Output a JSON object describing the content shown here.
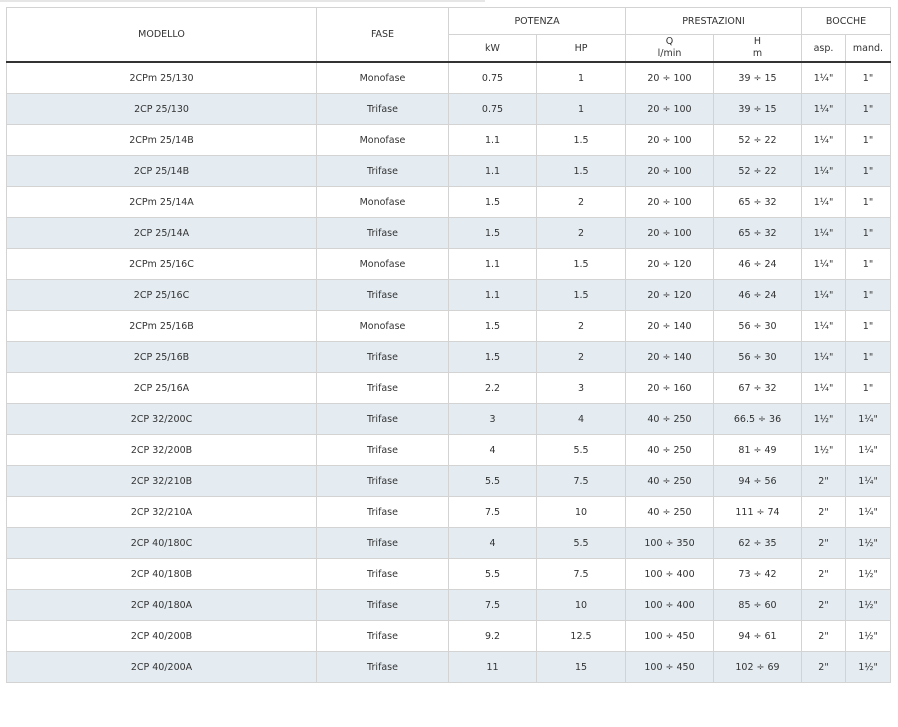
{
  "header": {
    "modello": "MODELLO",
    "fase": "FASE",
    "potenza": "POTENZA",
    "prestazioni": "PRESTAZIONI",
    "bocche": "BOCCHE",
    "kw": "kW",
    "hp": "HP",
    "q": "Q",
    "q_unit": "l/min",
    "h": "H",
    "h_unit": "m",
    "asp": "asp.",
    "mand": "mand."
  },
  "rows": [
    {
      "modello": "2CPm 25/130",
      "fase": "Monofase",
      "kw": "0.75",
      "hp": "1",
      "q": "20 ÷ 100",
      "h": "39 ÷ 15",
      "asp": "1¼\"",
      "mand": "1\""
    },
    {
      "modello": "2CP 25/130",
      "fase": "Trifase",
      "kw": "0.75",
      "hp": "1",
      "q": "20 ÷ 100",
      "h": "39 ÷ 15",
      "asp": "1¼\"",
      "mand": "1\""
    },
    {
      "modello": "2CPm 25/14B",
      "fase": "Monofase",
      "kw": "1.1",
      "hp": "1.5",
      "q": "20 ÷ 100",
      "h": "52 ÷ 22",
      "asp": "1¼\"",
      "mand": "1\""
    },
    {
      "modello": "2CP 25/14B",
      "fase": "Trifase",
      "kw": "1.1",
      "hp": "1.5",
      "q": "20 ÷ 100",
      "h": "52 ÷ 22",
      "asp": "1¼\"",
      "mand": "1\""
    },
    {
      "modello": "2CPm 25/14A",
      "fase": "Monofase",
      "kw": "1.5",
      "hp": "2",
      "q": "20 ÷ 100",
      "h": "65 ÷ 32",
      "asp": "1¼\"",
      "mand": "1\""
    },
    {
      "modello": "2CP 25/14A",
      "fase": "Trifase",
      "kw": "1.5",
      "hp": "2",
      "q": "20 ÷ 100",
      "h": "65 ÷ 32",
      "asp": "1¼\"",
      "mand": "1\""
    },
    {
      "modello": "2CPm 25/16C",
      "fase": "Monofase",
      "kw": "1.1",
      "hp": "1.5",
      "q": "20 ÷ 120",
      "h": "46 ÷ 24",
      "asp": "1¼\"",
      "mand": "1\""
    },
    {
      "modello": "2CP 25/16C",
      "fase": "Trifase",
      "kw": "1.1",
      "hp": "1.5",
      "q": "20 ÷ 120",
      "h": "46 ÷ 24",
      "asp": "1¼\"",
      "mand": "1\""
    },
    {
      "modello": "2CPm 25/16B",
      "fase": "Monofase",
      "kw": "1.5",
      "hp": "2",
      "q": "20 ÷ 140",
      "h": "56 ÷ 30",
      "asp": "1¼\"",
      "mand": "1\""
    },
    {
      "modello": "2CP 25/16B",
      "fase": "Trifase",
      "kw": "1.5",
      "hp": "2",
      "q": "20 ÷ 140",
      "h": "56 ÷ 30",
      "asp": "1¼\"",
      "mand": "1\""
    },
    {
      "modello": "2CP 25/16A",
      "fase": "Trifase",
      "kw": "2.2",
      "hp": "3",
      "q": "20 ÷ 160",
      "h": "67 ÷ 32",
      "asp": "1¼\"",
      "mand": "1\""
    },
    {
      "modello": "2CP 32/200C",
      "fase": "Trifase",
      "kw": "3",
      "hp": "4",
      "q": "40 ÷ 250",
      "h": "66.5 ÷ 36",
      "asp": "1½\"",
      "mand": "1¼\""
    },
    {
      "modello": "2CP 32/200B",
      "fase": "Trifase",
      "kw": "4",
      "hp": "5.5",
      "q": "40 ÷ 250",
      "h": "81 ÷ 49",
      "asp": "1½\"",
      "mand": "1¼\""
    },
    {
      "modello": "2CP 32/210B",
      "fase": "Trifase",
      "kw": "5.5",
      "hp": "7.5",
      "q": "40 ÷ 250",
      "h": "94 ÷ 56",
      "asp": "2\"",
      "mand": "1¼\""
    },
    {
      "modello": "2CP 32/210A",
      "fase": "Trifase",
      "kw": "7.5",
      "hp": "10",
      "q": "40 ÷ 250",
      "h": "111 ÷ 74",
      "asp": "2\"",
      "mand": "1¼\""
    },
    {
      "modello": "2CP 40/180C",
      "fase": "Trifase",
      "kw": "4",
      "hp": "5.5",
      "q": "100 ÷ 350",
      "h": "62 ÷ 35",
      "asp": "2\"",
      "mand": "1½\""
    },
    {
      "modello": "2CP 40/180B",
      "fase": "Trifase",
      "kw": "5.5",
      "hp": "7.5",
      "q": "100 ÷ 400",
      "h": "73 ÷ 42",
      "asp": "2\"",
      "mand": "1½\""
    },
    {
      "modello": "2CP 40/180A",
      "fase": "Trifase",
      "kw": "7.5",
      "hp": "10",
      "q": "100 ÷ 400",
      "h": "85 ÷ 60",
      "asp": "2\"",
      "mand": "1½\""
    },
    {
      "modello": "2CP 40/200B",
      "fase": "Trifase",
      "kw": "9.2",
      "hp": "12.5",
      "q": "100 ÷ 450",
      "h": "94 ÷ 61",
      "asp": "2\"",
      "mand": "1½\""
    },
    {
      "modello": "2CP 40/200A",
      "fase": "Trifase",
      "kw": "11",
      "hp": "15",
      "q": "100 ÷ 450",
      "h": "102 ÷ 69",
      "asp": "2\"",
      "mand": "1½\""
    }
  ]
}
